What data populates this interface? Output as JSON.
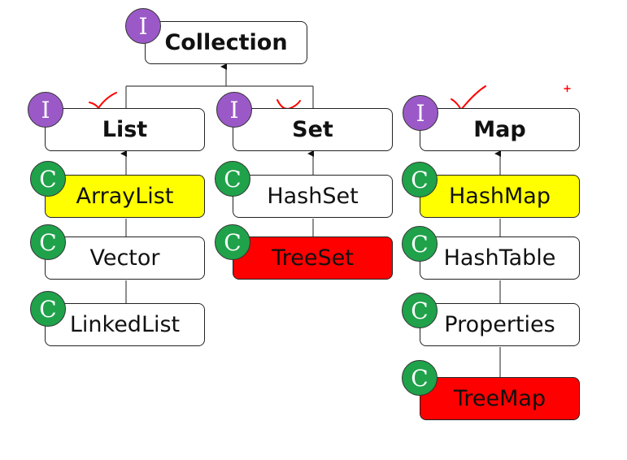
{
  "badges": {
    "interface": "I",
    "class": "C"
  },
  "colors": {
    "interface_badge": "#9b59c8",
    "class_badge": "#1fa24a",
    "highlight_yellow": "#ffff00",
    "highlight_red": "#ff0000",
    "annotation": "#ff0000"
  },
  "nodes": {
    "collection": {
      "label": "Collection",
      "kind": "interface"
    },
    "list": {
      "label": "List",
      "kind": "interface",
      "parent": "Collection"
    },
    "set": {
      "label": "Set",
      "kind": "interface",
      "parent": "Collection"
    },
    "map": {
      "label": "Map",
      "kind": "interface"
    },
    "arraylist": {
      "label": "ArrayList",
      "kind": "class",
      "parent": "List",
      "highlight": "yellow"
    },
    "vector": {
      "label": "Vector",
      "kind": "class",
      "parent": "List"
    },
    "linkedlist": {
      "label": "LinkedList",
      "kind": "class",
      "parent": "List"
    },
    "hashset": {
      "label": "HashSet",
      "kind": "class",
      "parent": "Set"
    },
    "treeset": {
      "label": "TreeSet",
      "kind": "class",
      "parent": "Set",
      "highlight": "red"
    },
    "hashmap": {
      "label": "HashMap",
      "kind": "class",
      "parent": "Map",
      "highlight": "yellow"
    },
    "hashtable": {
      "label": "HashTable",
      "kind": "class",
      "parent": "Map"
    },
    "properties": {
      "label": "Properties",
      "kind": "class",
      "parent": "Map"
    },
    "treemap": {
      "label": "TreeMap",
      "kind": "class",
      "parent": "Map",
      "highlight": "red"
    }
  }
}
